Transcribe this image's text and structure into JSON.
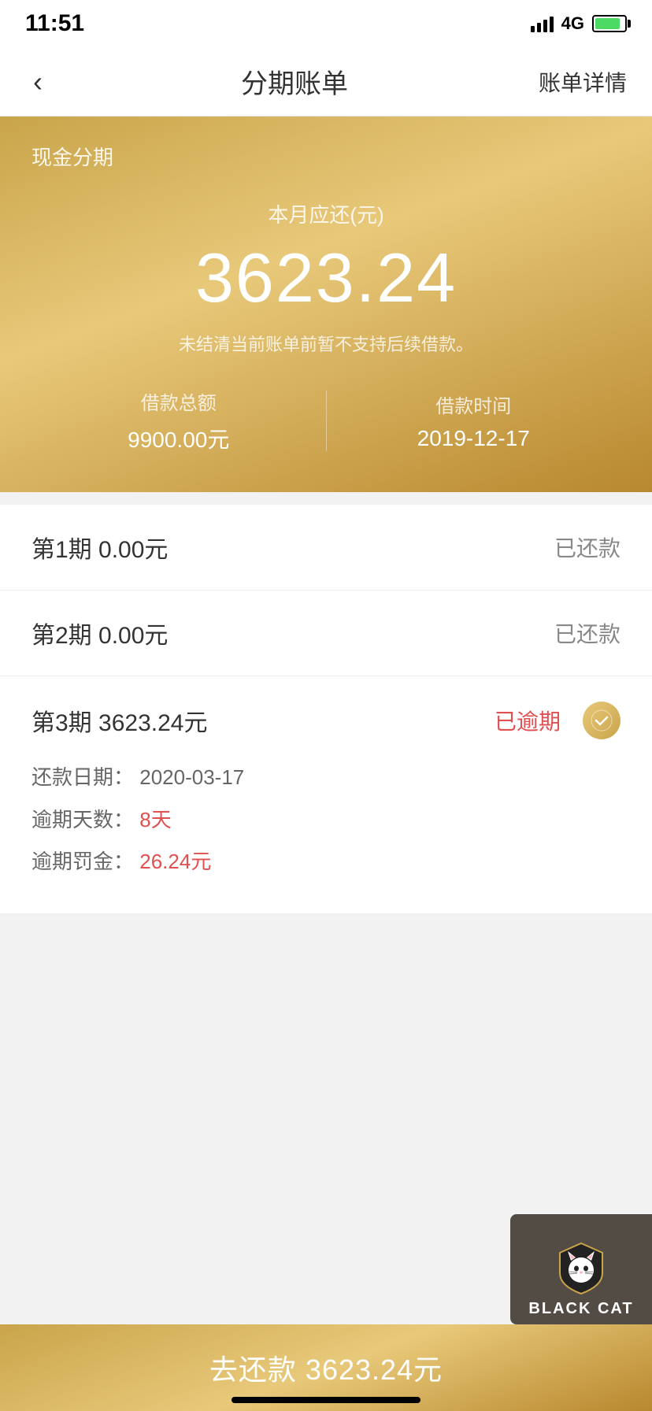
{
  "statusBar": {
    "time": "11:51",
    "network": "4G"
  },
  "navBar": {
    "backLabel": "‹",
    "title": "分期账单",
    "rightLabel": "账单详情"
  },
  "heroCard": {
    "sectionLabel": "现金分期",
    "amountLabel": "本月应还(元)",
    "amount": "3623.24",
    "notice": "未结清当前账单前暂不支持后续借款。",
    "loanTotalLabel": "借款总额",
    "loanTotalValue": "9900.00元",
    "loanDateLabel": "借款时间",
    "loanDateValue": "2019-12-17"
  },
  "installments": [
    {
      "label": "第1期  0.00元",
      "status": "已还款",
      "statusClass": "normal",
      "expanded": false
    },
    {
      "label": "第2期  0.00元",
      "status": "已还款",
      "statusClass": "normal",
      "expanded": false
    },
    {
      "label": "第3期  3623.24元",
      "status": "已逾期",
      "statusClass": "overdue",
      "expanded": true,
      "details": {
        "repayDateLabel": "还款日期：",
        "repayDateValue": "2020-03-17",
        "overdueDaysLabel": "逾期天数：",
        "overdueDaysValue": "8天",
        "overdueFineLabel": "逾期罚金：",
        "overdueFineValue": "26.24元"
      }
    }
  ],
  "bottomBar": {
    "label": "去还款  3623.24元"
  },
  "blackCat": {
    "text": "BLACK CAT"
  }
}
